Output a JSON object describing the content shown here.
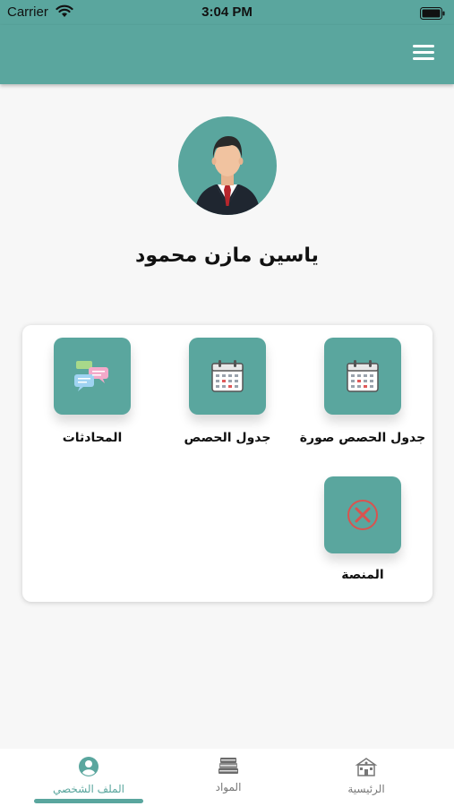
{
  "status_bar": {
    "carrier": "Carrier",
    "time": "3:04 PM"
  },
  "colors": {
    "accent": "#5aa69e",
    "background": "#f7f7f7",
    "close_red": "#d9534f"
  },
  "profile": {
    "name": "ياسين مازن محمود",
    "avatar_icon": "user-avatar-icon"
  },
  "tiles": {
    "schedule_image": {
      "label": "جدول الحصص صورة",
      "icon": "calendar-icon"
    },
    "schedule": {
      "label": "جدول الحصص",
      "icon": "calendar-icon"
    },
    "chats": {
      "label": "المحادثات",
      "icon": "chat-bubbles-icon"
    },
    "platform": {
      "label": "المنصة",
      "icon": "close-circle-icon"
    }
  },
  "bottom_nav": {
    "items": [
      {
        "label": "الملف الشخصي",
        "icon": "profile-icon",
        "active": true
      },
      {
        "label": "المواد",
        "icon": "books-icon",
        "active": false
      },
      {
        "label": "الرئيسية",
        "icon": "school-icon",
        "active": false
      }
    ]
  }
}
